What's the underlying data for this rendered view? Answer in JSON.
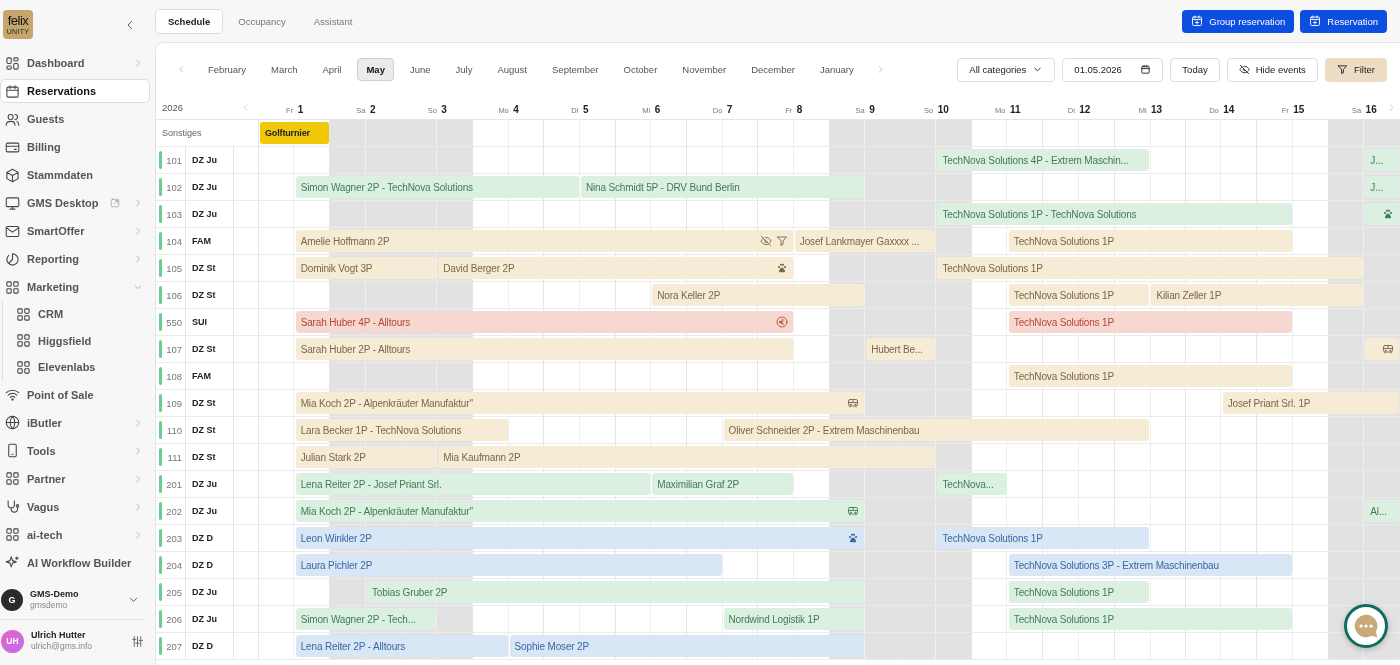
{
  "sidebar": {
    "logo": {
      "word": "felix",
      "sub": "UNITY"
    },
    "items": [
      {
        "label": "Dashboard",
        "selected": false,
        "expanded": false,
        "external": false
      },
      {
        "label": "Reservations",
        "selected": true,
        "external": false
      },
      {
        "label": "Guests",
        "selected": false,
        "external": false
      },
      {
        "label": "Billing",
        "selected": false,
        "external": false
      },
      {
        "label": "Stammdaten",
        "selected": false,
        "external": false
      },
      {
        "label": "GMS Desktop",
        "selected": false,
        "expanded": false,
        "external": true
      },
      {
        "label": "SmartOffer",
        "selected": false,
        "expanded": false,
        "external": false
      },
      {
        "label": "Reporting",
        "selected": false,
        "expanded": false,
        "external": false
      },
      {
        "label": "Marketing",
        "selected": false,
        "expanded": true,
        "external": false,
        "children": [
          {
            "label": "CRM",
            "selected": false
          },
          {
            "label": "Higgsfield",
            "selected": false
          },
          {
            "label": "Elevenlabs",
            "selected": false
          }
        ]
      },
      {
        "label": "Point of Sale",
        "selected": false,
        "external": false
      },
      {
        "label": "iButler",
        "selected": false,
        "expanded": false,
        "external": false
      },
      {
        "label": "Tools",
        "selected": false,
        "expanded": false,
        "external": false
      },
      {
        "label": "Partner",
        "selected": false,
        "expanded": false,
        "external": false
      },
      {
        "label": "Vagus",
        "selected": false,
        "expanded": false,
        "external": false
      },
      {
        "label": "ai-tech",
        "selected": false,
        "expanded": false,
        "external": false
      },
      {
        "label": "AI Workflow Builder",
        "selected": false,
        "external": false
      }
    ],
    "workspace": {
      "initial": "G",
      "name": "GMS-Demo",
      "handle": "gmsdemo"
    },
    "user": {
      "initials": "UH",
      "name": "Ulrich Hutter",
      "email": "ulrich@gms.info"
    }
  },
  "tabs": [
    {
      "label": "Schedule",
      "selected": true
    },
    {
      "label": "Occupancy",
      "selected": false
    },
    {
      "label": "Assistant",
      "selected": false
    }
  ],
  "actions": [
    "Group reservation",
    "Reservation"
  ],
  "schedule": {
    "months": [
      {
        "label": "February",
        "selected": false
      },
      {
        "label": "March",
        "selected": false
      },
      {
        "label": "April",
        "selected": false
      },
      {
        "label": "May",
        "selected": true
      },
      {
        "label": "June",
        "selected": false
      },
      {
        "label": "July",
        "selected": false
      },
      {
        "label": "August",
        "selected": false
      },
      {
        "label": "September",
        "selected": false
      },
      {
        "label": "October",
        "selected": false
      },
      {
        "label": "November",
        "selected": false
      },
      {
        "label": "December",
        "selected": false
      },
      {
        "label": "January",
        "selected": false
      }
    ],
    "category_filter": "All categories",
    "date": "01.05.2026",
    "buttons": [
      {
        "label": "Today",
        "active": false
      },
      {
        "label": "Hide events",
        "active": false
      },
      {
        "label": "Filter",
        "active": true
      }
    ],
    "year": "2026",
    "days": [
      {
        "weekday": "Fr",
        "day": "1",
        "weekend": false
      },
      {
        "weekday": "Sa",
        "day": "2",
        "weekend": true
      },
      {
        "weekday": "So",
        "day": "3",
        "weekend": true
      },
      {
        "weekday": "Mo",
        "day": "4",
        "weekend": false
      },
      {
        "weekday": "Di",
        "day": "5",
        "weekend": false
      },
      {
        "weekday": "Mi",
        "day": "6",
        "weekend": false
      },
      {
        "weekday": "Do",
        "day": "7",
        "weekend": false
      },
      {
        "weekday": "Fr",
        "day": "8",
        "weekend": false
      },
      {
        "weekday": "Sa",
        "day": "9",
        "weekend": true
      },
      {
        "weekday": "So",
        "day": "10",
        "weekend": true
      },
      {
        "weekday": "Mo",
        "day": "11",
        "weekend": false
      },
      {
        "weekday": "Di",
        "day": "12",
        "weekend": false
      },
      {
        "weekday": "Mi",
        "day": "13",
        "weekend": false
      },
      {
        "weekday": "Do",
        "day": "14",
        "weekend": false
      },
      {
        "weekday": "Fr",
        "day": "15",
        "weekend": false
      },
      {
        "weekday": "Sa",
        "day": "16",
        "weekend": true
      }
    ],
    "event_rows": [
      {
        "label": "Sonstiges",
        "events": [
          {
            "title": "Golfturnier",
            "color": "#f0c808"
          }
        ],
        "days": [
          {
            "kind": "arrival"
          },
          {
            "kind": "free"
          },
          {
            "kind": "free"
          },
          {
            "kind": "free"
          },
          {
            "kind": "free"
          },
          {
            "kind": "free"
          },
          {
            "kind": "free"
          },
          {
            "kind": "free"
          },
          {
            "kind": "free"
          },
          {
            "kind": "free"
          },
          {
            "kind": "free"
          },
          {
            "kind": "free"
          },
          {
            "kind": "free"
          },
          {
            "kind": "free"
          },
          {
            "kind": "free"
          },
          {
            "kind": "free"
          }
        ]
      }
    ],
    "rooms": [
      {
        "number": "101",
        "category": "DZ Ju",
        "bookings": [
          {
            "guest": "TechNova Solutions 4P - Extrem Maschin...",
            "color": "#dcf0e1"
          },
          {
            "guest": "J...",
            "color": "#dcf0e1"
          }
        ],
        "nights": [
          {
            "kind": "free"
          },
          {
            "kind": "free"
          },
          {
            "kind": "free"
          },
          {
            "kind": "free"
          },
          {
            "kind": "free"
          },
          {
            "kind": "free"
          },
          {
            "kind": "free"
          },
          {
            "kind": "free"
          },
          {
            "kind": "free"
          },
          {
            "kind": "arrival"
          },
          {
            "kind": "stay"
          },
          {
            "kind": "stay"
          },
          {
            "kind": "free"
          },
          {
            "kind": "free"
          },
          {
            "kind": "free"
          },
          {
            "kind": "arrival"
          }
        ]
      },
      {
        "number": "102",
        "category": "DZ Ju",
        "bookings": [
          {
            "guest": "Simon Wagner 2P - TechNova Solutions",
            "color": "#dcf0e1"
          },
          {
            "guest": "Nina Schmidt 5P - DRV Bund Berlin",
            "color": "#dcf0e1"
          },
          {
            "guest": "J...",
            "color": "#dcf0e1"
          }
        ],
        "nights": [
          {
            "kind": "arrival"
          },
          {
            "kind": "stay"
          },
          {
            "kind": "stay"
          },
          {
            "kind": "stay"
          },
          {
            "kind": "arrival"
          },
          {
            "kind": "stay"
          },
          {
            "kind": "stay"
          },
          {
            "kind": "stay"
          },
          {
            "kind": "free"
          },
          {
            "kind": "free"
          },
          {
            "kind": "free"
          },
          {
            "kind": "free"
          },
          {
            "kind": "free"
          },
          {
            "kind": "free"
          },
          {
            "kind": "free"
          },
          {
            "kind": "arrival"
          }
        ]
      },
      {
        "number": "103",
        "category": "DZ Ju",
        "bookings": [
          {
            "guest": "TechNova Solutions 1P - TechNova Solutions",
            "color": "#dcf0e1"
          },
          {
            "color": "#dcf0e1",
            "icons": [
              {
                "kind": "pet"
              }
            ]
          }
        ],
        "nights": [
          {
            "kind": "free"
          },
          {
            "kind": "free"
          },
          {
            "kind": "free"
          },
          {
            "kind": "free"
          },
          {
            "kind": "free"
          },
          {
            "kind": "free"
          },
          {
            "kind": "free"
          },
          {
            "kind": "free"
          },
          {
            "kind": "free"
          },
          {
            "kind": "arrival"
          },
          {
            "kind": "stay"
          },
          {
            "kind": "stay"
          },
          {
            "kind": "stay"
          },
          {
            "kind": "stay"
          },
          {
            "kind": "free"
          },
          {
            "kind": "arrival"
          }
        ]
      },
      {
        "number": "104",
        "category": "FAM",
        "bookings": [
          {
            "guest": "Amelie Hoffmann 2P",
            "color": "#f6ebd5",
            "icons": [
              {
                "kind": "hidden"
              },
              {
                "kind": "filtered"
              }
            ]
          },
          {
            "guest": "Josef Lankmayer Gaxxxx ...",
            "color": "#f6ebd5"
          },
          {
            "guest": "TechNova Solutions 1P",
            "color": "#f6ebd5"
          }
        ],
        "nights": [
          {
            "kind": "arrival"
          },
          {
            "kind": "stay"
          },
          {
            "kind": "stay"
          },
          {
            "kind": "stay"
          },
          {
            "kind": "stay"
          },
          {
            "kind": "stay"
          },
          {
            "kind": "stay"
          },
          {
            "kind": "arrival"
          },
          {
            "kind": "stay"
          },
          {
            "kind": "free"
          },
          {
            "kind": "arrival"
          },
          {
            "kind": "stay"
          },
          {
            "kind": "stay"
          },
          {
            "kind": "stay"
          },
          {
            "kind": "free"
          },
          {
            "kind": "free"
          }
        ]
      },
      {
        "number": "105",
        "category": "DZ St",
        "bookings": [
          {
            "guest": "Dominik Vogt 3P",
            "color": "#f6ebd5"
          },
          {
            "guest": "David Berger 2P",
            "color": "#f6ebd5",
            "icons": [
              {
                "kind": "pet"
              }
            ]
          },
          {
            "guest": "TechNova Solutions 1P",
            "color": "#f6ebd5"
          }
        ],
        "nights": [
          {
            "kind": "arrival"
          },
          {
            "kind": "stay"
          },
          {
            "kind": "arrival"
          },
          {
            "kind": "stay"
          },
          {
            "kind": "stay"
          },
          {
            "kind": "stay"
          },
          {
            "kind": "stay"
          },
          {
            "kind": "free"
          },
          {
            "kind": "free"
          },
          {
            "kind": "arrival"
          },
          {
            "kind": "stay"
          },
          {
            "kind": "stay"
          },
          {
            "kind": "stay"
          },
          {
            "kind": "stay"
          },
          {
            "kind": "stay"
          },
          {
            "kind": "free"
          }
        ]
      },
      {
        "number": "106",
        "category": "DZ St",
        "bookings": [
          {
            "guest": "Nora Keller 2P",
            "color": "#f6ebd5"
          },
          {
            "guest": "TechNova Solutions 1P",
            "color": "#f6ebd5"
          },
          {
            "guest": "Kilian Zeller 1P",
            "color": "#f6ebd5"
          }
        ],
        "nights": [
          {
            "kind": "free"
          },
          {
            "kind": "free"
          },
          {
            "kind": "free"
          },
          {
            "kind": "free"
          },
          {
            "kind": "free"
          },
          {
            "kind": "arrival"
          },
          {
            "kind": "stay"
          },
          {
            "kind": "stay"
          },
          {
            "kind": "free"
          },
          {
            "kind": "free"
          },
          {
            "kind": "arrival"
          },
          {
            "kind": "stay"
          },
          {
            "kind": "arrival"
          },
          {
            "kind": "stay"
          },
          {
            "kind": "stay"
          },
          {
            "kind": "free"
          }
        ]
      },
      {
        "number": "550",
        "category": "SUI",
        "bookings": [
          {
            "guest": "Sarah Huber 4P - Alltours",
            "color": "#f7d8d0",
            "icons": [
              {
                "kind": "payment"
              }
            ]
          },
          {
            "guest": "TechNova Solutions 1P",
            "color": "#f7d8d0"
          }
        ],
        "nights": [
          {
            "kind": "arrival"
          },
          {
            "kind": "stay"
          },
          {
            "kind": "stay"
          },
          {
            "kind": "stay"
          },
          {
            "kind": "stay"
          },
          {
            "kind": "stay"
          },
          {
            "kind": "stay"
          },
          {
            "kind": "free"
          },
          {
            "kind": "free"
          },
          {
            "kind": "free"
          },
          {
            "kind": "arrival"
          },
          {
            "kind": "stay"
          },
          {
            "kind": "stay"
          },
          {
            "kind": "stay"
          },
          {
            "kind": "free"
          },
          {
            "kind": "free"
          }
        ]
      },
      {
        "number": "107",
        "category": "DZ St",
        "bookings": [
          {
            "guest": "Sarah Huber 2P - Alltours",
            "color": "#f6ebd5"
          },
          {
            "guest": "Hubert Be...",
            "color": "#f6ebd5"
          },
          {
            "color": "#f6ebd5",
            "icons": [
              {
                "kind": "bus"
              }
            ]
          }
        ],
        "nights": [
          {
            "kind": "arrival"
          },
          {
            "kind": "stay"
          },
          {
            "kind": "stay"
          },
          {
            "kind": "stay"
          },
          {
            "kind": "stay"
          },
          {
            "kind": "stay"
          },
          {
            "kind": "stay"
          },
          {
            "kind": "free"
          },
          {
            "kind": "arrival"
          },
          {
            "kind": "free"
          },
          {
            "kind": "free"
          },
          {
            "kind": "free"
          },
          {
            "kind": "free"
          },
          {
            "kind": "free"
          },
          {
            "kind": "free"
          },
          {
            "kind": "arrival"
          }
        ]
      },
      {
        "number": "108",
        "category": "FAM",
        "bookings": [
          {
            "guest": "TechNova Solutions 1P",
            "color": "#f6ebd5"
          }
        ],
        "nights": [
          {
            "kind": "free"
          },
          {
            "kind": "free"
          },
          {
            "kind": "free"
          },
          {
            "kind": "free"
          },
          {
            "kind": "free"
          },
          {
            "kind": "free"
          },
          {
            "kind": "free"
          },
          {
            "kind": "free"
          },
          {
            "kind": "free"
          },
          {
            "kind": "free"
          },
          {
            "kind": "arrival"
          },
          {
            "kind": "stay"
          },
          {
            "kind": "stay"
          },
          {
            "kind": "stay"
          },
          {
            "kind": "free"
          },
          {
            "kind": "free"
          }
        ]
      },
      {
        "number": "109",
        "category": "DZ St",
        "bookings": [
          {
            "guest": "Mia Koch 2P - Alpenkräuter Manufaktur\"",
            "color": "#f6ebd5",
            "icons": [
              {
                "kind": "bus"
              }
            ]
          },
          {
            "guest": "Josef Priant Srl. 1P",
            "color": "#f6ebd5"
          }
        ],
        "nights": [
          {
            "kind": "arrival"
          },
          {
            "kind": "stay"
          },
          {
            "kind": "stay"
          },
          {
            "kind": "stay"
          },
          {
            "kind": "stay"
          },
          {
            "kind": "stay"
          },
          {
            "kind": "stay"
          },
          {
            "kind": "stay"
          },
          {
            "kind": "free"
          },
          {
            "kind": "free"
          },
          {
            "kind": "free"
          },
          {
            "kind": "free"
          },
          {
            "kind": "free"
          },
          {
            "kind": "arrival"
          },
          {
            "kind": "stay"
          },
          {
            "kind": "stay"
          }
        ]
      },
      {
        "number": "110",
        "category": "DZ St",
        "bookings": [
          {
            "guest": "Lara Becker 1P - TechNova Solutions",
            "color": "#f6ebd5"
          },
          {
            "guest": "Oliver Schneider 2P - Extrem Maschinenbau",
            "color": "#f6ebd5"
          }
        ],
        "nights": [
          {
            "kind": "arrival"
          },
          {
            "kind": "stay"
          },
          {
            "kind": "stay"
          },
          {
            "kind": "free"
          },
          {
            "kind": "free"
          },
          {
            "kind": "free"
          },
          {
            "kind": "arrival"
          },
          {
            "kind": "stay"
          },
          {
            "kind": "stay"
          },
          {
            "kind": "stay"
          },
          {
            "kind": "stay"
          },
          {
            "kind": "stay"
          },
          {
            "kind": "free"
          },
          {
            "kind": "free"
          },
          {
            "kind": "free"
          },
          {
            "kind": "free"
          }
        ]
      },
      {
        "number": "111",
        "category": "DZ St",
        "bookings": [
          {
            "guest": "Julian Stark 2P",
            "color": "#f6ebd5"
          },
          {
            "guest": "Mia Kaufmann 2P",
            "color": "#f6ebd5"
          }
        ],
        "nights": [
          {
            "kind": "arrival"
          },
          {
            "kind": "stay"
          },
          {
            "kind": "arrival"
          },
          {
            "kind": "stay"
          },
          {
            "kind": "stay"
          },
          {
            "kind": "stay"
          },
          {
            "kind": "stay"
          },
          {
            "kind": "stay"
          },
          {
            "kind": "stay"
          },
          {
            "kind": "free"
          },
          {
            "kind": "free"
          },
          {
            "kind": "free"
          },
          {
            "kind": "free"
          },
          {
            "kind": "free"
          },
          {
            "kind": "free"
          },
          {
            "kind": "free"
          }
        ]
      },
      {
        "number": "201",
        "category": "DZ Ju",
        "bookings": [
          {
            "guest": "Lena Reiter 2P - Josef Priant Srl.",
            "color": "#dcf0e1"
          },
          {
            "guest": "Maximilian Graf 2P",
            "color": "#dcf0e1"
          },
          {
            "guest": "TechNova...",
            "color": "#dcf0e1"
          }
        ],
        "nights": [
          {
            "kind": "arrival"
          },
          {
            "kind": "stay"
          },
          {
            "kind": "stay"
          },
          {
            "kind": "stay"
          },
          {
            "kind": "stay"
          },
          {
            "kind": "arrival"
          },
          {
            "kind": "stay"
          },
          {
            "kind": "free"
          },
          {
            "kind": "free"
          },
          {
            "kind": "arrival"
          },
          {
            "kind": "free"
          },
          {
            "kind": "free"
          },
          {
            "kind": "free"
          },
          {
            "kind": "free"
          },
          {
            "kind": "free"
          },
          {
            "kind": "free"
          }
        ]
      },
      {
        "number": "202",
        "category": "DZ Ju",
        "bookings": [
          {
            "guest": "Mia Koch 2P - Alpenkräuter Manufaktur\"",
            "color": "#dcf0e1",
            "icons": [
              {
                "kind": "bus"
              }
            ]
          },
          {
            "guest": "Al...",
            "color": "#dcf0e1"
          }
        ],
        "nights": [
          {
            "kind": "arrival"
          },
          {
            "kind": "stay"
          },
          {
            "kind": "stay"
          },
          {
            "kind": "stay"
          },
          {
            "kind": "stay"
          },
          {
            "kind": "stay"
          },
          {
            "kind": "stay"
          },
          {
            "kind": "stay"
          },
          {
            "kind": "free"
          },
          {
            "kind": "free"
          },
          {
            "kind": "free"
          },
          {
            "kind": "free"
          },
          {
            "kind": "free"
          },
          {
            "kind": "free"
          },
          {
            "kind": "free"
          },
          {
            "kind": "arrival"
          }
        ]
      },
      {
        "number": "203",
        "category": "DZ D",
        "bookings": [
          {
            "guest": "Leon Winkler 2P",
            "color": "#d9e6f5",
            "icons": [
              {
                "kind": "pet"
              }
            ]
          },
          {
            "guest": "TechNova Solutions 1P",
            "color": "#d9e6f5"
          }
        ],
        "nights": [
          {
            "kind": "arrival"
          },
          {
            "kind": "stay"
          },
          {
            "kind": "stay"
          },
          {
            "kind": "stay"
          },
          {
            "kind": "stay"
          },
          {
            "kind": "stay"
          },
          {
            "kind": "stay"
          },
          {
            "kind": "stay"
          },
          {
            "kind": "free"
          },
          {
            "kind": "arrival"
          },
          {
            "kind": "stay"
          },
          {
            "kind": "stay"
          },
          {
            "kind": "free"
          },
          {
            "kind": "free"
          },
          {
            "kind": "free"
          },
          {
            "kind": "free"
          }
        ]
      },
      {
        "number": "204",
        "category": "DZ D",
        "bookings": [
          {
            "guest": "Laura Pichler 2P",
            "color": "#d9e6f5"
          },
          {
            "guest": "TechNova Solutions 3P - Extrem Maschinenbau",
            "color": "#d9e6f5"
          }
        ],
        "nights": [
          {
            "kind": "arrival"
          },
          {
            "kind": "stay"
          },
          {
            "kind": "stay"
          },
          {
            "kind": "stay"
          },
          {
            "kind": "stay"
          },
          {
            "kind": "stay"
          },
          {
            "kind": "free"
          },
          {
            "kind": "free"
          },
          {
            "kind": "free"
          },
          {
            "kind": "free"
          },
          {
            "kind": "arrival"
          },
          {
            "kind": "stay"
          },
          {
            "kind": "stay"
          },
          {
            "kind": "stay"
          },
          {
            "kind": "free"
          },
          {
            "kind": "free"
          }
        ]
      },
      {
        "number": "205",
        "category": "DZ Ju",
        "bookings": [
          {
            "guest": "Tobias Gruber 2P",
            "color": "#dcf0e1"
          },
          {
            "guest": "TechNova Solutions 1P",
            "color": "#dcf0e1"
          }
        ],
        "nights": [
          {
            "kind": "free"
          },
          {
            "kind": "arrival"
          },
          {
            "kind": "stay"
          },
          {
            "kind": "stay"
          },
          {
            "kind": "stay"
          },
          {
            "kind": "stay"
          },
          {
            "kind": "stay"
          },
          {
            "kind": "stay"
          },
          {
            "kind": "free"
          },
          {
            "kind": "free"
          },
          {
            "kind": "arrival"
          },
          {
            "kind": "stay"
          },
          {
            "kind": "free"
          },
          {
            "kind": "free"
          },
          {
            "kind": "free"
          },
          {
            "kind": "free"
          }
        ]
      },
      {
        "number": "206",
        "category": "DZ Ju",
        "bookings": [
          {
            "guest": "Simon Wagner 2P - Tech...",
            "color": "#dcf0e1"
          },
          {
            "guest": "Nordwind Logistik 1P",
            "color": "#dcf0e1"
          },
          {
            "guest": "TechNova Solutions 1P",
            "color": "#dcf0e1"
          }
        ],
        "nights": [
          {
            "kind": "arrival"
          },
          {
            "kind": "stay"
          },
          {
            "kind": "free"
          },
          {
            "kind": "free"
          },
          {
            "kind": "free"
          },
          {
            "kind": "free"
          },
          {
            "kind": "arrival"
          },
          {
            "kind": "stay"
          },
          {
            "kind": "free"
          },
          {
            "kind": "free"
          },
          {
            "kind": "arrival"
          },
          {
            "kind": "stay"
          },
          {
            "kind": "stay"
          },
          {
            "kind": "stay"
          },
          {
            "kind": "free"
          },
          {
            "kind": "free"
          }
        ]
      },
      {
        "number": "207",
        "category": "DZ D",
        "bookings": [
          {
            "guest": "Lena Reiter 2P - Alltours",
            "color": "#d9e6f5"
          },
          {
            "guest": "Sophie Moser 2P",
            "color": "#d9e6f5"
          }
        ],
        "nights": [
          {
            "kind": "arrival"
          },
          {
            "kind": "stay"
          },
          {
            "kind": "stay"
          },
          {
            "kind": "arrival"
          },
          {
            "kind": "stay"
          },
          {
            "kind": "stay"
          },
          {
            "kind": "stay"
          },
          {
            "kind": "stay"
          },
          {
            "kind": "free"
          },
          {
            "kind": "free"
          },
          {
            "kind": "free"
          },
          {
            "kind": "free"
          },
          {
            "kind": "free"
          },
          {
            "kind": "free"
          },
          {
            "kind": "free"
          },
          {
            "kind": "free"
          }
        ]
      }
    ]
  }
}
